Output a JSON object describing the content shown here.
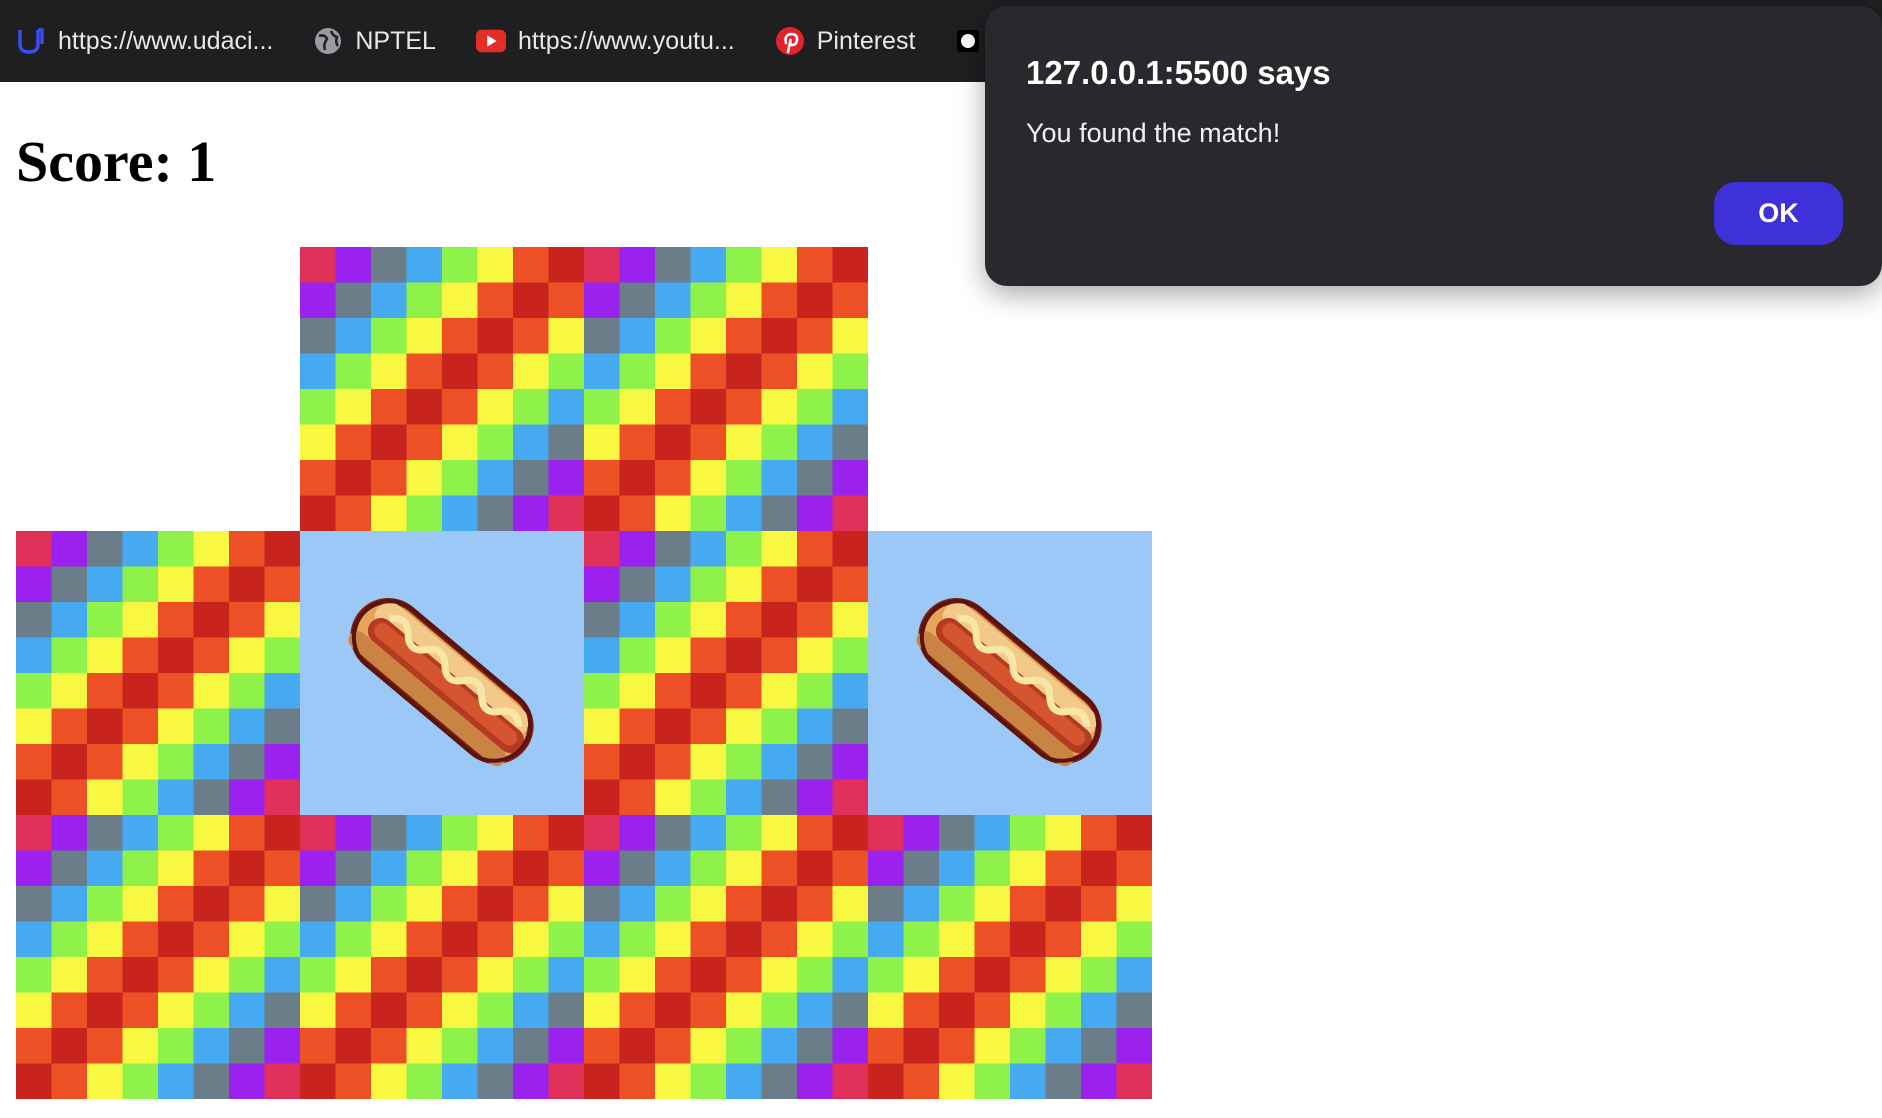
{
  "bookmarks": [
    {
      "label": "https://www.udaci...",
      "icon": "udacity-icon"
    },
    {
      "label": "NPTEL",
      "icon": "globe-icon"
    },
    {
      "label": "https://www.youtu...",
      "icon": "youtube-icon"
    },
    {
      "label": "Pinterest",
      "icon": "pinterest-icon"
    }
  ],
  "page": {
    "score_text": "Score: 1",
    "card_back": "rainbow-checker-pattern",
    "revealed_item": "hotdog-image",
    "cards": [
      [
        "empty",
        "back",
        "back",
        "empty"
      ],
      [
        "back",
        "hotdog",
        "back",
        "hotdog"
      ],
      [
        "back",
        "back",
        "back",
        "back"
      ]
    ]
  },
  "dialog": {
    "title": "127.0.0.1:5500 says",
    "message": "You found the match!",
    "ok_label": "OK",
    "accent": "#3f31d8",
    "background": "#29292d"
  }
}
